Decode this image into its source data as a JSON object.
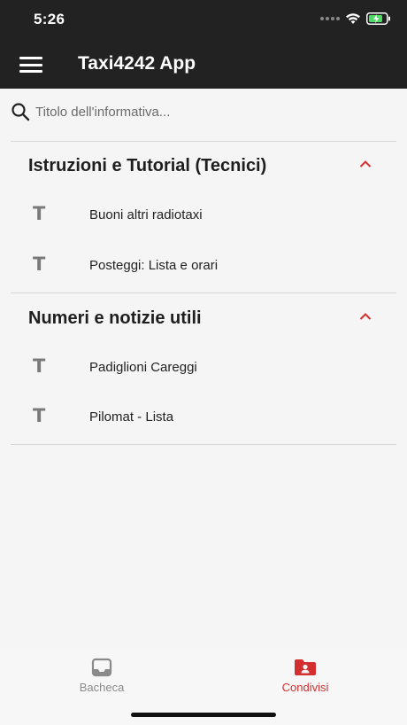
{
  "status_bar": {
    "time": "5:26"
  },
  "header": {
    "title": "Taxi4242 App",
    "menu_icon": "hamburger-menu-icon"
  },
  "search": {
    "placeholder": "Titolo dell'informativa...",
    "value": ""
  },
  "sections": [
    {
      "title": "Istruzioni e Tutorial (Tecnici)",
      "expanded": true,
      "items": [
        {
          "icon": "T",
          "label": "Buoni altri radiotaxi"
        },
        {
          "icon": "T",
          "label": "Posteggi: Lista e orari"
        }
      ]
    },
    {
      "title": "Numeri e notizie utili",
      "expanded": true,
      "items": [
        {
          "icon": "T",
          "label": "Padiglioni Careggi"
        },
        {
          "icon": "T",
          "label": "Pilomat - Lista"
        }
      ]
    }
  ],
  "tabs": [
    {
      "label": "Bacheca",
      "icon": "inbox-icon",
      "active": false
    },
    {
      "label": "Condivisi",
      "icon": "shared-folder-icon",
      "active": true
    }
  ],
  "colors": {
    "header_bg": "#222222",
    "accent": "#d32f2f",
    "inactive_tab": "#8a8a8a",
    "background": "#f5f5f5"
  }
}
